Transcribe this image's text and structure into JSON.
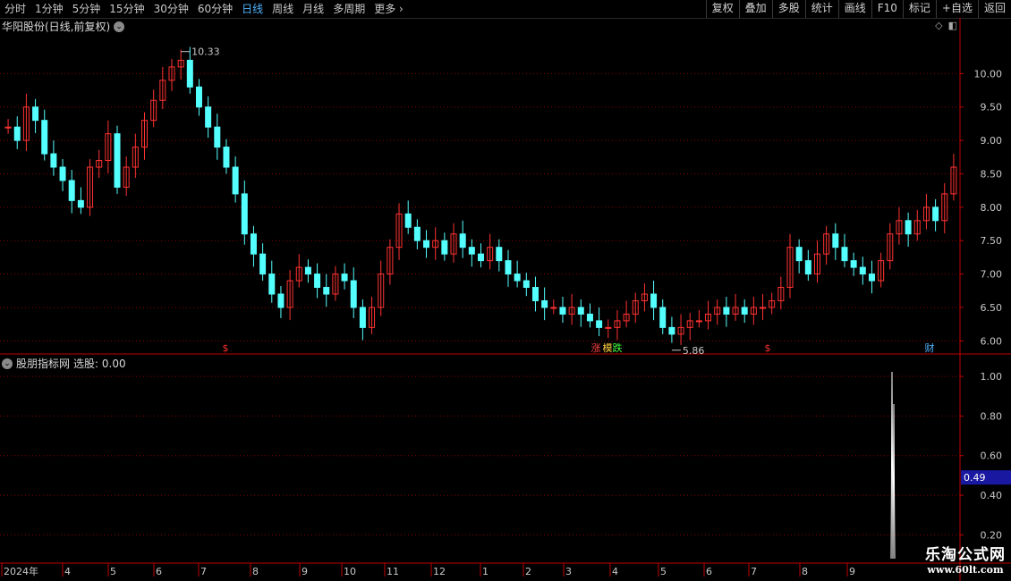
{
  "toolbar": {
    "tabs": [
      {
        "label": "分时",
        "active": false
      },
      {
        "label": "1分钟",
        "active": false
      },
      {
        "label": "5分钟",
        "active": false
      },
      {
        "label": "15分钟",
        "active": false
      },
      {
        "label": "30分钟",
        "active": false
      },
      {
        "label": "60分钟",
        "active": false
      },
      {
        "label": "日线",
        "active": true
      },
      {
        "label": "周线",
        "active": false
      },
      {
        "label": "月线",
        "active": false
      },
      {
        "label": "多周期",
        "active": false
      },
      {
        "label": "更多",
        "active": false
      }
    ],
    "more_icon": "chevron-right-icon",
    "tools": [
      "复权",
      "叠加",
      "多股",
      "统计",
      "画线",
      "F10",
      "标记",
      "+自选",
      "返回"
    ]
  },
  "main_chart": {
    "title": "华阳股份(日线,前复权)",
    "high_label": "10.33",
    "low_label": "5.86",
    "markers": [
      {
        "text": "$",
        "color": "#ff3030"
      },
      {
        "text": "涨",
        "color": "#ff4040"
      },
      {
        "text": "模",
        "color": "#ffd040"
      },
      {
        "text": "跌",
        "color": "#40ff40"
      },
      {
        "text": "$",
        "color": "#ff3030"
      },
      {
        "text": "财",
        "color": "#4fb3ff"
      }
    ],
    "y_ticks": [
      "10.00",
      "9.50",
      "9.00",
      "8.50",
      "8.00",
      "7.50",
      "7.00",
      "6.50",
      "6.00"
    ]
  },
  "indicator": {
    "title": "股朋指标网",
    "value_label": "选股: 0.00",
    "current_value": "0.49",
    "y_ticks": [
      "1.00",
      "0.80",
      "0.60",
      "0.40",
      "0.20"
    ]
  },
  "x_axis": {
    "labels": [
      "2024年",
      "4",
      "5",
      "6",
      "7",
      "8",
      "9",
      "10",
      "11",
      "12",
      "1",
      "2",
      "3",
      "4",
      "5",
      "6",
      "7",
      "8",
      "9"
    ]
  },
  "watermark": {
    "main": "乐淘公式网",
    "url": "www.60lt.com"
  },
  "colors": {
    "up": "#ff3232",
    "down": "#54ffff",
    "grid": "#8b0000",
    "axis": "#c00000",
    "accent": "#4fb3ff"
  },
  "chart_data": {
    "type": "candlestick",
    "ylim": [
      5.75,
      10.5
    ],
    "high_point": 10.33,
    "low_point": 5.86,
    "closes": [
      9.2,
      9.0,
      9.5,
      9.3,
      8.8,
      8.6,
      8.4,
      8.1,
      8.0,
      8.6,
      8.7,
      9.1,
      8.3,
      8.6,
      8.9,
      9.3,
      9.6,
      9.9,
      10.1,
      10.2,
      9.8,
      9.5,
      9.2,
      8.9,
      8.6,
      8.2,
      7.6,
      7.3,
      7.0,
      6.7,
      6.5,
      6.9,
      7.1,
      7.0,
      6.8,
      6.7,
      7.0,
      6.9,
      6.5,
      6.2,
      6.5,
      7.0,
      7.4,
      7.9,
      7.7,
      7.5,
      7.4,
      7.5,
      7.3,
      7.6,
      7.4,
      7.3,
      7.2,
      7.4,
      7.2,
      7.0,
      6.9,
      6.8,
      6.6,
      6.5,
      6.5,
      6.4,
      6.5,
      6.4,
      6.3,
      6.2,
      6.2,
      6.3,
      6.4,
      6.6,
      6.7,
      6.5,
      6.2,
      6.1,
      6.2,
      6.3,
      6.3,
      6.4,
      6.5,
      6.4,
      6.5,
      6.4,
      6.5,
      6.5,
      6.6,
      6.8,
      7.4,
      7.2,
      7.0,
      7.3,
      7.6,
      7.4,
      7.2,
      7.1,
      7.0,
      6.9,
      7.2,
      7.6,
      7.8,
      7.6,
      7.8,
      8.0,
      7.8,
      8.2,
      8.6
    ]
  }
}
